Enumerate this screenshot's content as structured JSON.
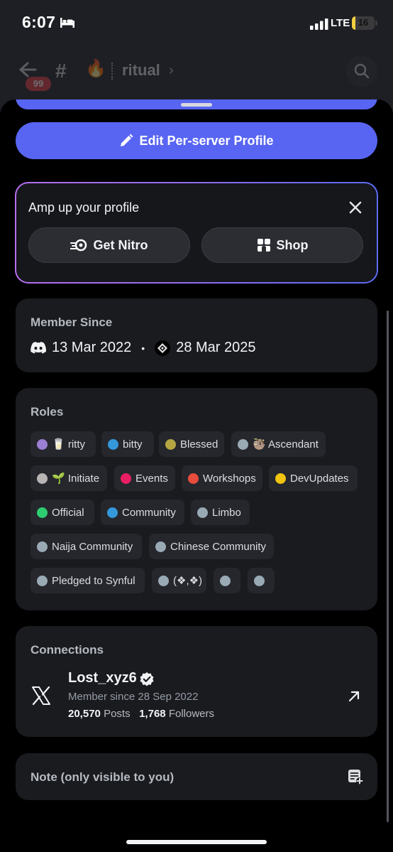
{
  "status_bar": {
    "time": "6:07",
    "network": "LTE",
    "battery": "16",
    "battery_level": 0.16
  },
  "header": {
    "badge_count": "99",
    "channel_emoji": "🔥",
    "channel_name": "ritual"
  },
  "actions": {
    "edit_profile_label": "Edit Per-server Profile"
  },
  "amp": {
    "title": "Amp up your profile",
    "nitro_label": "Get Nitro",
    "shop_label": "Shop"
  },
  "member_since": {
    "title": "Member Since",
    "discord_date": "13 Mar 2022",
    "server_date": "28 Mar 2025"
  },
  "roles": {
    "title": "Roles",
    "items": [
      {
        "label": "🥛 ritty",
        "color": "#9b7fd4"
      },
      {
        "label": "bitty",
        "color": "#3498db"
      },
      {
        "label": "Blessed",
        "color": "#b5a642"
      },
      {
        "label": "🦥 Ascendant",
        "color": "#99aab5"
      },
      {
        "label": "🌱 Initiate",
        "color": "#b9b4b4"
      },
      {
        "label": "Events",
        "color": "#e91e63"
      },
      {
        "label": "Workshops",
        "color": "#e74c3c"
      },
      {
        "label": "DevUpdates",
        "color": "#f1c40f"
      },
      {
        "label": "Official",
        "color": "#2ecc71"
      },
      {
        "label": "Community",
        "color": "#3498db"
      },
      {
        "label": "Limbo",
        "color": "#99aab5"
      },
      {
        "label": "Naija Community",
        "color": "#99aab5"
      },
      {
        "label": "Chinese Community",
        "color": "#99aab5"
      },
      {
        "label": "Pledged to Synful",
        "color": "#99aab5"
      },
      {
        "label": "(❖,❖)",
        "color": "#99aab5"
      },
      {
        "label": "",
        "color": "#99aab5"
      },
      {
        "label": "",
        "color": "#99aab5"
      }
    ]
  },
  "connections": {
    "title": "Connections",
    "account": {
      "name": "Lost_xyz6",
      "since": "Member since 28 Sep 2022",
      "posts_count": "20,570",
      "posts_label": "Posts",
      "followers_count": "1,768",
      "followers_label": "Followers"
    }
  },
  "note": {
    "label": "Note (only visible to you)"
  }
}
